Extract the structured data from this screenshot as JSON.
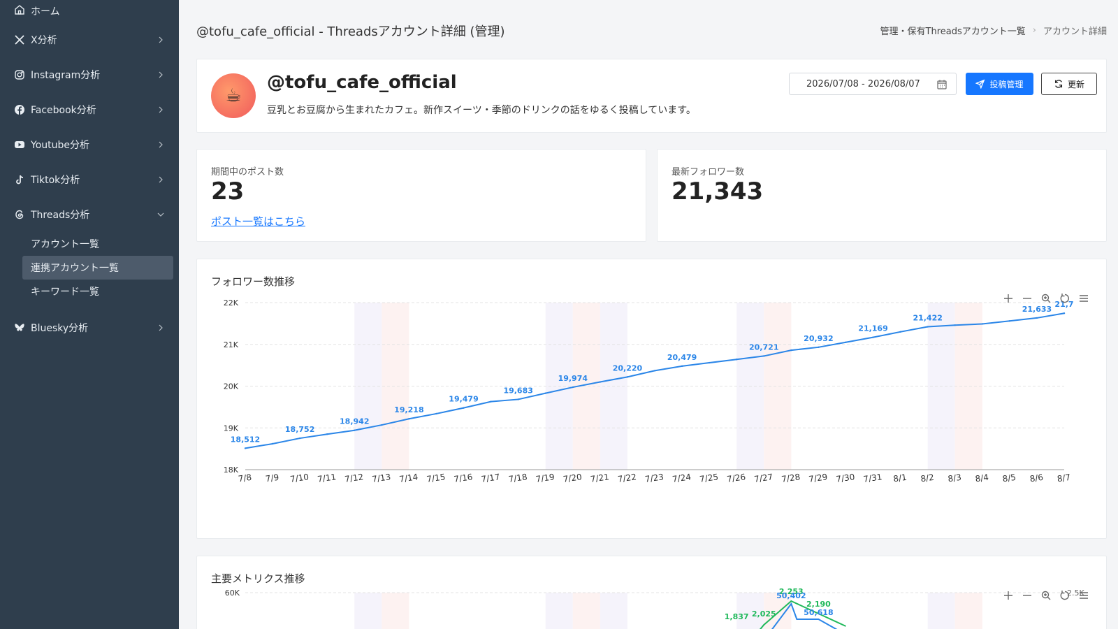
{
  "sidebar": {
    "home": "ホーム",
    "items": [
      {
        "label": "X分析",
        "icon": "x-logo-icon"
      },
      {
        "label": "Instagram分析",
        "icon": "instagram-icon"
      },
      {
        "label": "Facebook分析",
        "icon": "facebook-icon"
      },
      {
        "label": "Youtube分析",
        "icon": "youtube-icon"
      },
      {
        "label": "Tiktok分析",
        "icon": "tiktok-icon"
      },
      {
        "label": "Threads分析",
        "icon": "threads-icon"
      },
      {
        "label": "Bluesky分析",
        "icon": "bluesky-icon"
      }
    ],
    "threads_sub": [
      "アカウント一覧",
      "連携アカウント一覧",
      "キーワード一覧"
    ],
    "active_sub": "連携アカウント一覧",
    "bg_color": "#2f3e4d"
  },
  "header": {
    "title": "@tofu_cafe_official - Threadsアカウント詳細 (管理)",
    "breadcrumb": [
      "管理・保有Threadsアカウント一覧",
      "アカウント詳細"
    ]
  },
  "profile": {
    "avatar": "☕",
    "handle": "@tofu_cafe_official",
    "bio": "豆乳とお豆腐から生まれたカフェ。新作スイーツ・季節のドリンクの話をゆるく投稿しています。",
    "date_range": "2026/07/08 - 2026/08/07",
    "post_manage_label": "投稿管理",
    "refresh_label": "更新",
    "accent": "#1677ff"
  },
  "stats": {
    "posts_label": "期間中のポスト数",
    "posts_value": "23",
    "posts_link": "ポスト一覧はこちら",
    "followers_label": "最新フォロワー数",
    "followers_value": "21,343"
  },
  "chart_data": [
    {
      "type": "line",
      "title": "フォロワー数推移",
      "categories": [
        "7/8",
        "7/9",
        "7/10",
        "7/11",
        "7/12",
        "7/13",
        "7/14",
        "7/15",
        "7/16",
        "7/17",
        "7/18",
        "7/19",
        "7/20",
        "7/21",
        "7/22",
        "7/23",
        "7/24",
        "7/25",
        "7/26",
        "7/27",
        "7/28",
        "7/29",
        "7/30",
        "7/31",
        "8/1",
        "8/2",
        "8/3",
        "8/4",
        "8/5",
        "8/6",
        "8/7"
      ],
      "values": [
        18512,
        18620,
        18752,
        18850,
        18942,
        19070,
        19218,
        19340,
        19479,
        19630,
        19683,
        19830,
        19974,
        20100,
        20220,
        20370,
        20479,
        20560,
        20640,
        20721,
        20860,
        20932,
        21050,
        21169,
        21300,
        21422,
        21460,
        21490,
        21560,
        21633,
        21745
      ],
      "data_labels": [
        {
          "i": 0,
          "text": "18,512"
        },
        {
          "i": 2,
          "text": "18,752"
        },
        {
          "i": 4,
          "text": "18,942"
        },
        {
          "i": 6,
          "text": "19,218"
        },
        {
          "i": 8,
          "text": "19,479"
        },
        {
          "i": 10,
          "text": "19,683"
        },
        {
          "i": 12,
          "text": "19,974"
        },
        {
          "i": 14,
          "text": "20,220"
        },
        {
          "i": 16,
          "text": "20,479"
        },
        {
          "i": 19,
          "text": "20,721"
        },
        {
          "i": 21,
          "text": "20,932"
        },
        {
          "i": 23,
          "text": "21,169"
        },
        {
          "i": 25,
          "text": "21,422"
        },
        {
          "i": 29,
          "text": "21,633"
        },
        {
          "i": 30,
          "text": "21,7"
        }
      ],
      "y_ticks": [
        "18K",
        "19K",
        "20K",
        "21K",
        "22K"
      ],
      "ylim": [
        18000,
        22000
      ],
      "weekend_bands": [
        [
          4,
          5
        ],
        [
          11,
          13
        ],
        [
          18,
          19
        ],
        [
          25,
          26
        ]
      ],
      "grid": true,
      "line_color": "#2b86e8"
    },
    {
      "type": "line",
      "title": "主要メトリクス推移",
      "y_ticks_left": [
        "60K"
      ],
      "y_ticks_right": [
        "2.5K"
      ],
      "visible_labels": [
        "2,253",
        "50,402",
        "2,190",
        "50,618",
        "2,025",
        "1,837"
      ]
    }
  ]
}
